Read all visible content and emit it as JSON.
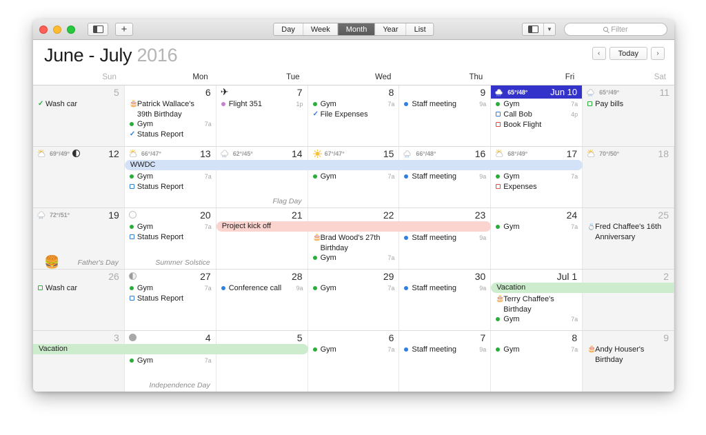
{
  "window": {
    "traffic_lights": [
      "close",
      "minimize",
      "zoom"
    ],
    "sidebar_toggle_label": "sidebar-toggle",
    "add_label": "+",
    "view_tabs": [
      {
        "label": "Day",
        "active": false
      },
      {
        "label": "Week",
        "active": false
      },
      {
        "label": "Month",
        "active": true
      },
      {
        "label": "Year",
        "active": false
      },
      {
        "label": "List",
        "active": false
      }
    ],
    "calendar_picker_label": "calendars",
    "filter_placeholder": "Filter"
  },
  "header": {
    "title_main": "June - July",
    "title_year": "2016",
    "prev_label": "‹",
    "today_label": "Today",
    "next_label": "›"
  },
  "weekdays": [
    {
      "label": "Sun",
      "weekend": true
    },
    {
      "label": "Mon",
      "weekend": false
    },
    {
      "label": "Tue",
      "weekend": false
    },
    {
      "label": "Wed",
      "weekend": false
    },
    {
      "label": "Thu",
      "weekend": false
    },
    {
      "label": "Fri",
      "weekend": false
    },
    {
      "label": "Sat",
      "weekend": true
    }
  ],
  "colors": {
    "today_highlight": "#3333cc",
    "banner_blue": "#d3e2f7",
    "banner_pink": "#fbd3cf",
    "banner_green": "#cdeccd",
    "event_green": "#27ae39",
    "event_blue": "#2f7fe0",
    "event_red": "#e8453c",
    "event_purple": "#c77fd4"
  },
  "weeks": [
    {
      "days": [
        {
          "num": "5",
          "dim": true,
          "weekend": true,
          "events": [
            {
              "mark": "check",
              "color": "#27ae39",
              "title": "Wash car",
              "time": ""
            }
          ]
        },
        {
          "num": "6",
          "dim": false,
          "weekend": false,
          "events": [
            {
              "mark": "cake",
              "color": "#e8453c",
              "title": "Patrick Wallace's 39th Birthday",
              "time": ""
            },
            {
              "mark": "dot",
              "color": "#27ae39",
              "title": "Gym",
              "time": "7a"
            },
            {
              "mark": "check",
              "color": "#2f7fe0",
              "title": "Status Report",
              "time": ""
            }
          ]
        },
        {
          "num": "7",
          "dim": false,
          "weekend": false,
          "icon": "airplane",
          "events": [
            {
              "mark": "dot",
              "color": "#c77fd4",
              "title": "Flight 351",
              "time": "1p"
            }
          ]
        },
        {
          "num": "8",
          "dim": false,
          "weekend": false,
          "events": [
            {
              "mark": "dot",
              "color": "#27ae39",
              "title": "Gym",
              "time": "7a"
            },
            {
              "mark": "check",
              "color": "#2f7fe0",
              "title": "File Expenses",
              "time": ""
            }
          ]
        },
        {
          "num": "9",
          "dim": false,
          "weekend": false,
          "events": [
            {
              "mark": "dot",
              "color": "#2f7fe0",
              "title": "Staff meeting",
              "time": "9a"
            }
          ]
        },
        {
          "num": "Jun 10",
          "dim": false,
          "weekend": false,
          "today": true,
          "weather": {
            "icon": "rain-sun",
            "temps": "65°/48°"
          },
          "events": [
            {
              "mark": "dot",
              "color": "#27ae39",
              "title": "Gym",
              "time": "7a"
            },
            {
              "mark": "square",
              "color": "#2f7fe0",
              "title": "Call Bob",
              "time": "4p"
            },
            {
              "mark": "square",
              "color": "#e8453c",
              "title": "Book Flight",
              "time": ""
            }
          ]
        },
        {
          "num": "11",
          "dim": true,
          "weekend": true,
          "weather": {
            "icon": "rain-sun",
            "temps": "65°/49°"
          },
          "events": [
            {
              "mark": "square",
              "color": "#27ae39",
              "title": "Pay bills",
              "time": ""
            }
          ]
        }
      ],
      "banners": []
    },
    {
      "days": [
        {
          "num": "12",
          "dim": false,
          "weekend": true,
          "weather": {
            "icon": "sun-cloud",
            "temps": "69°/49°"
          },
          "moon": "half-left",
          "events": []
        },
        {
          "num": "13",
          "dim": false,
          "weekend": false,
          "weather": {
            "icon": "sun-cloud",
            "temps": "66°/47°"
          },
          "events": [
            {
              "mark": "dot",
              "color": "#27ae39",
              "title": "Gym",
              "time": "7a"
            },
            {
              "mark": "square",
              "color": "#2f7fe0",
              "title": "Status Report",
              "time": ""
            }
          ]
        },
        {
          "num": "14",
          "dim": false,
          "weekend": false,
          "weather": {
            "icon": "rain",
            "temps": "62°/45°"
          },
          "holiday": "Flag Day",
          "events": []
        },
        {
          "num": "15",
          "dim": false,
          "weekend": false,
          "weather": {
            "icon": "sun",
            "temps": "67°/47°"
          },
          "events": [
            {
              "mark": "dot",
              "color": "#27ae39",
              "title": "Gym",
              "time": "7a"
            }
          ]
        },
        {
          "num": "16",
          "dim": false,
          "weekend": false,
          "weather": {
            "icon": "rain-sun",
            "temps": "66°/48°"
          },
          "events": [
            {
              "mark": "dot",
              "color": "#2f7fe0",
              "title": "Staff meeting",
              "time": "9a"
            }
          ]
        },
        {
          "num": "17",
          "dim": false,
          "weekend": false,
          "weather": {
            "icon": "sun-cloud",
            "temps": "68°/49°"
          },
          "events": [
            {
              "mark": "dot",
              "color": "#27ae39",
              "title": "Gym",
              "time": "7a"
            },
            {
              "mark": "square",
              "color": "#e8453c",
              "title": "Expenses",
              "time": ""
            }
          ]
        },
        {
          "num": "18",
          "dim": true,
          "weekend": true,
          "weather": {
            "icon": "sun-cloud",
            "temps": "70°/50°"
          },
          "events": []
        }
      ],
      "banners": [
        {
          "label": "WWDC",
          "style": "blue",
          "start": 1,
          "span": 5,
          "row": 0
        }
      ]
    },
    {
      "days": [
        {
          "num": "19",
          "dim": false,
          "weekend": true,
          "weather": {
            "icon": "rain",
            "temps": "72°/51°"
          },
          "holiday": "Father's Day",
          "emoji": "🍔",
          "events": []
        },
        {
          "num": "20",
          "dim": false,
          "weekend": false,
          "moon": "new",
          "holiday": "Summer Solstice",
          "events": [
            {
              "mark": "dot",
              "color": "#27ae39",
              "title": "Gym",
              "time": "7a"
            },
            {
              "mark": "square",
              "color": "#2f7fe0",
              "title": "Status Report",
              "time": ""
            }
          ]
        },
        {
          "num": "21",
          "dim": false,
          "weekend": false,
          "events": []
        },
        {
          "num": "22",
          "dim": false,
          "weekend": false,
          "events": [
            {
              "mark": "cake",
              "color": "#e8453c",
              "title": "Brad Wood's 27th Birthday",
              "time": ""
            },
            {
              "mark": "dot",
              "color": "#27ae39",
              "title": "Gym",
              "time": "7a"
            }
          ]
        },
        {
          "num": "23",
          "dim": false,
          "weekend": false,
          "events": [
            {
              "mark": "dot",
              "color": "#2f7fe0",
              "title": "Staff meeting",
              "time": "9a"
            }
          ]
        },
        {
          "num": "24",
          "dim": false,
          "weekend": false,
          "events": [
            {
              "mark": "dot",
              "color": "#27ae39",
              "title": "Gym",
              "time": "7a"
            }
          ]
        },
        {
          "num": "25",
          "dim": true,
          "weekend": true,
          "events": [
            {
              "mark": "ring",
              "color": "#e8453c",
              "title": "Fred Chaffee's 16th Anniversary",
              "time": ""
            }
          ]
        }
      ],
      "banners": [
        {
          "label": "Project kick off",
          "style": "pink",
          "start": 2,
          "span": 3,
          "row": 0
        }
      ]
    },
    {
      "days": [
        {
          "num": "26",
          "dim": true,
          "weekend": true,
          "events": [
            {
              "mark": "square",
              "color": "#27ae39",
              "title": "Wash car",
              "time": ""
            }
          ]
        },
        {
          "num": "27",
          "dim": false,
          "weekend": false,
          "moon": "half-left-gray",
          "events": [
            {
              "mark": "dot",
              "color": "#27ae39",
              "title": "Gym",
              "time": "7a"
            },
            {
              "mark": "square",
              "color": "#2f7fe0",
              "title": "Status Report",
              "time": ""
            }
          ]
        },
        {
          "num": "28",
          "dim": false,
          "weekend": false,
          "events": [
            {
              "mark": "dot",
              "color": "#2f7fe0",
              "title": "Conference call",
              "time": "9a"
            }
          ]
        },
        {
          "num": "29",
          "dim": false,
          "weekend": false,
          "events": [
            {
              "mark": "dot",
              "color": "#27ae39",
              "title": "Gym",
              "time": "7a"
            }
          ]
        },
        {
          "num": "30",
          "dim": false,
          "weekend": false,
          "events": [
            {
              "mark": "dot",
              "color": "#2f7fe0",
              "title": "Staff meeting",
              "time": "9a"
            }
          ]
        },
        {
          "num": "Jul 1",
          "dim": false,
          "weekend": false,
          "events": [
            {
              "mark": "cake",
              "color": "#e8453c",
              "title": "Terry Chaffee's Birthday",
              "time": ""
            },
            {
              "mark": "dot",
              "color": "#27ae39",
              "title": "Gym",
              "time": "7a"
            }
          ]
        },
        {
          "num": "2",
          "dim": true,
          "weekend": true,
          "events": []
        }
      ],
      "banners": [
        {
          "label": "Vacation",
          "style": "green",
          "start": 5,
          "span": 2,
          "row": 0,
          "open_right": true
        }
      ]
    },
    {
      "days": [
        {
          "num": "3",
          "dim": true,
          "weekend": true,
          "events": []
        },
        {
          "num": "4",
          "dim": false,
          "weekend": false,
          "moon": "full-gray",
          "holiday": "Independence Day",
          "events": [
            {
              "mark": "dot",
              "color": "#27ae39",
              "title": "Gym",
              "time": "7a"
            }
          ]
        },
        {
          "num": "5",
          "dim": false,
          "weekend": false,
          "events": []
        },
        {
          "num": "6",
          "dim": false,
          "weekend": false,
          "events": [
            {
              "mark": "dot",
              "color": "#27ae39",
              "title": "Gym",
              "time": "7a"
            }
          ]
        },
        {
          "num": "7",
          "dim": false,
          "weekend": false,
          "events": [
            {
              "mark": "dot",
              "color": "#2f7fe0",
              "title": "Staff meeting",
              "time": "9a"
            }
          ]
        },
        {
          "num": "8",
          "dim": false,
          "weekend": false,
          "events": [
            {
              "mark": "dot",
              "color": "#27ae39",
              "title": "Gym",
              "time": "7a"
            }
          ]
        },
        {
          "num": "9",
          "dim": true,
          "weekend": true,
          "events": [
            {
              "mark": "cake",
              "color": "#e8453c",
              "title": "Andy Houser's Birthday",
              "time": ""
            }
          ]
        }
      ],
      "banners": [
        {
          "label": "Vacation",
          "style": "green",
          "start": 0,
          "span": 3,
          "row": 0,
          "open_left": true
        }
      ]
    }
  ]
}
